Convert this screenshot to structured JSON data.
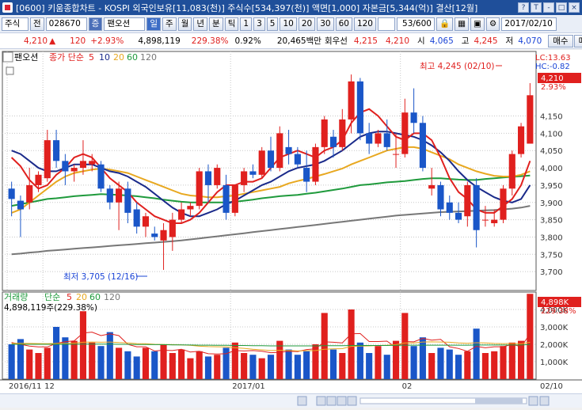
{
  "titlebar": {
    "title": "[0600] 키움종합차트 - KOSPI 외국인보유[11,083(천)] 주식수[534,397(천)] 액면[1,000] 자본금[5,344(억)] 결산[12월]",
    "buttons": [
      "?",
      "T",
      "-",
      "□",
      "×"
    ]
  },
  "toolbar": {
    "market": "주식",
    "all_label": "전",
    "code": "028670",
    "badge": "증",
    "stock_name": "팬오션",
    "periods": [
      "일",
      "주",
      "월",
      "년",
      "분",
      "틱"
    ],
    "active_period": "일",
    "minutes": [
      "1",
      "3",
      "5",
      "10",
      "20",
      "30",
      "60",
      "120"
    ],
    "count": "53/600",
    "date": "2017/02/10"
  },
  "pricebar": {
    "price": "4,210",
    "change_arrow": "▲",
    "change": "120",
    "change_pct": "+2.93%",
    "volume": "4,898,119",
    "volume_ratio": "229.38%",
    "turnover": "0.92%",
    "amount": "20,465백만",
    "reset_label": "회우선",
    "ask": "4,215",
    "bid": "4,210",
    "open_label": "시",
    "open": "4,065",
    "high_label": "고",
    "high": "4,245",
    "low_label": "저",
    "low": "4,070",
    "buy_label": "매수",
    "sell_label": "매도"
  },
  "price_panel": {
    "name": "팬오션",
    "legend_prefix": "종가 단순",
    "legend_periods": [
      "5",
      "10",
      "20",
      "60",
      "120"
    ],
    "lc": "LC:13.63",
    "hc": "HC:-0.82",
    "last_price": "4,210",
    "last_pct": "2.93%",
    "high_annotation": "최고 4,245 (02/10)",
    "low_annotation": "최저 3,705 (12/16)"
  },
  "volume_panel": {
    "name": "거래량",
    "legend_prefix": "단순",
    "legend_periods": [
      "5",
      "20",
      "60",
      "120"
    ],
    "info": "4,898,119주(229.38%)",
    "last_volume": "4,898K",
    "last_pct": "229.38%"
  },
  "xaxis": {
    "labels": [
      {
        "text": "2016/11",
        "idx": 0
      },
      {
        "text": "12",
        "idx": 4
      },
      {
        "text": "2017/01",
        "idx": 25
      },
      {
        "text": "02",
        "idx": 44
      }
    ],
    "right_label": "02/10"
  },
  "colors": {
    "up": "#e0201e",
    "down": "#1a56c8",
    "ma5": "#e0201e",
    "ma10": "#1a2a8a",
    "ma20": "#e8a820",
    "ma60": "#1f9a3c",
    "ma120": "#777777"
  },
  "chart_data": {
    "type": "candlestick",
    "ylim": [
      3650,
      4300
    ],
    "yticks": [
      3700,
      3750,
      3800,
      3850,
      3900,
      3950,
      4000,
      4050,
      4100,
      4150
    ],
    "vol_yticks": [
      1000000,
      2000000,
      3000000,
      4000000
    ],
    "vol_ylim": [
      0,
      5000000
    ],
    "candles": [
      [
        3940,
        3960,
        3860,
        3910
      ],
      [
        3905,
        3920,
        3800,
        3880
      ],
      [
        3900,
        4000,
        3880,
        3950
      ],
      [
        3950,
        3990,
        3930,
        3980
      ],
      [
        3970,
        4110,
        3960,
        4080
      ],
      [
        4080,
        4110,
        4000,
        4020
      ],
      [
        4020,
        4040,
        3950,
        3990
      ],
      [
        3990,
        4010,
        3960,
        4000
      ],
      [
        4000,
        4080,
        3980,
        4020
      ],
      [
        4010,
        4040,
        3990,
        4020
      ],
      [
        4010,
        4020,
        3930,
        3940
      ],
      [
        3940,
        3950,
        3880,
        3900
      ],
      [
        3900,
        3960,
        3820,
        3940
      ],
      [
        3940,
        3960,
        3840,
        3870
      ],
      [
        3880,
        3900,
        3810,
        3830
      ],
      [
        3830,
        3870,
        3800,
        3860
      ],
      [
        3810,
        3830,
        3790,
        3800
      ],
      [
        3790,
        3840,
        3705,
        3820
      ],
      [
        3800,
        3870,
        3760,
        3850
      ],
      [
        3850,
        3900,
        3840,
        3880
      ],
      [
        3880,
        3900,
        3860,
        3890
      ],
      [
        3890,
        4000,
        3880,
        3990
      ],
      [
        3990,
        4010,
        3900,
        3950
      ],
      [
        3950,
        4010,
        3940,
        4000
      ],
      [
        3950,
        3980,
        3850,
        3870
      ],
      [
        3870,
        3950,
        3860,
        3950
      ],
      [
        3950,
        4000,
        3930,
        3990
      ],
      [
        3990,
        4010,
        3970,
        3980
      ],
      [
        3980,
        4060,
        3970,
        4050
      ],
      [
        4050,
        4090,
        3990,
        4000
      ],
      [
        4000,
        4120,
        3990,
        4100
      ],
      [
        4060,
        4110,
        4010,
        4040
      ],
      [
        4040,
        4060,
        4000,
        4010
      ],
      [
        4000,
        4050,
        3930,
        3960
      ],
      [
        3960,
        4070,
        3950,
        4060
      ],
      [
        4060,
        4150,
        4040,
        4140
      ],
      [
        4090,
        4110,
        4030,
        4060
      ],
      [
        4060,
        4170,
        4050,
        4140
      ],
      [
        4140,
        4270,
        4100,
        4250
      ],
      [
        4250,
        4260,
        4080,
        4100
      ],
      [
        4100,
        4130,
        4040,
        4070
      ],
      [
        4070,
        4110,
        4060,
        4100
      ],
      [
        4100,
        4140,
        4050,
        4060
      ],
      [
        4040,
        4100,
        4000,
        4040
      ],
      [
        4040,
        4200,
        4030,
        4160
      ],
      [
        4160,
        4230,
        4100,
        4130
      ],
      [
        4130,
        4150,
        3990,
        4000
      ],
      [
        3940,
        4000,
        3920,
        3950
      ],
      [
        3950,
        3960,
        3860,
        3880
      ],
      [
        3900,
        3920,
        3850,
        3870
      ],
      [
        3870,
        3900,
        3840,
        3850
      ],
      [
        3860,
        3960,
        3830,
        3950
      ],
      [
        3950,
        3970,
        3770,
        3820
      ],
      [
        3850,
        3890,
        3830,
        3850
      ],
      [
        3840,
        3880,
        3830,
        3850
      ],
      [
        3850,
        3950,
        3840,
        3940
      ],
      [
        3940,
        4050,
        3920,
        4040
      ],
      [
        4040,
        4130,
        4030,
        4120
      ],
      [
        4070,
        4245,
        4070,
        4210
      ]
    ],
    "volumes": [
      2000000,
      2300000,
      1700000,
      1500000,
      1800000,
      3000000,
      2400000,
      2200000,
      3900000,
      2100000,
      1900000,
      2700000,
      1800000,
      1600000,
      1300000,
      1800000,
      1600000,
      2000000,
      1500000,
      1700000,
      1200000,
      1600000,
      1300000,
      1400000,
      1800000,
      2100000,
      1500000,
      1400000,
      1200000,
      1400000,
      2200000,
      1700000,
      1400000,
      1600000,
      2000000,
      3800000,
      1700000,
      1500000,
      4000000,
      2100000,
      1500000,
      1900000,
      1400000,
      2200000,
      3800000,
      1900000,
      2400000,
      1500000,
      1800000,
      1700000,
      1400000,
      1600000,
      2900000,
      1500000,
      1600000,
      1900000,
      2100000,
      2200000,
      4898000
    ],
    "ma": {
      "ma5": [
        4030,
        4005,
        3965,
        3940,
        3950,
        3980,
        4000,
        4030,
        4040,
        4030,
        4000,
        3970,
        3950,
        3930,
        3900,
        3880,
        3860,
        3850,
        3840,
        3840,
        3850,
        3870,
        3900,
        3930,
        3950,
        3950,
        3960,
        3960,
        3970,
        4000,
        4030,
        4040,
        4050,
        4040,
        4030,
        4050,
        4060,
        4080,
        4130,
        4160,
        4170,
        4150,
        4120,
        4090,
        4080,
        4100,
        4100,
        4080,
        4030,
        3970,
        3930,
        3910,
        3880,
        3870,
        3870,
        3890,
        3910,
        3950,
        4020
      ],
      "ma10": [
        4050,
        4040,
        4020,
        4000,
        3990,
        3990,
        4000,
        4010,
        4010,
        4010,
        4000,
        3990,
        3985,
        3975,
        3960,
        3945,
        3925,
        3905,
        3885,
        3870,
        3860,
        3860,
        3870,
        3880,
        3895,
        3905,
        3920,
        3935,
        3950,
        3960,
        3975,
        3990,
        4000,
        4005,
        4010,
        4020,
        4035,
        4050,
        4070,
        4090,
        4100,
        4105,
        4105,
        4100,
        4095,
        4090,
        4080,
        4065,
        4045,
        4020,
        3990,
        3965,
        3945,
        3930,
        3915,
        3905,
        3900,
        3910,
        3950
      ],
      "ma20": [
        3870,
        3880,
        3900,
        3920,
        3940,
        3960,
        3975,
        3985,
        3990,
        3995,
        3998,
        3995,
        3990,
        3985,
        3975,
        3965,
        3955,
        3945,
        3935,
        3925,
        3920,
        3918,
        3915,
        3915,
        3918,
        3920,
        3925,
        3930,
        3935,
        3940,
        3945,
        3955,
        3962,
        3968,
        3975,
        3982,
        3990,
        3998,
        4010,
        4020,
        4030,
        4040,
        4050,
        4055,
        4060,
        4060,
        4055,
        4045,
        4035,
        4025,
        4010,
        4000,
        3990,
        3983,
        3977,
        3975,
        3975,
        3980,
        3990
      ],
      "ma60": [
        3890,
        3895,
        3900,
        3905,
        3910,
        3912,
        3915,
        3918,
        3920,
        3922,
        3924,
        3923,
        3922,
        3920,
        3918,
        3915,
        3912,
        3908,
        3905,
        3902,
        3900,
        3900,
        3900,
        3900,
        3900,
        3902,
        3905,
        3908,
        3912,
        3915,
        3918,
        3920,
        3922,
        3925,
        3928,
        3932,
        3936,
        3940,
        3945,
        3950,
        3952,
        3955,
        3958,
        3960,
        3962,
        3965,
        3968,
        3970,
        3970,
        3968,
        3966,
        3965,
        3965,
        3968,
        3970,
        3972,
        3974,
        3976,
        3978
      ],
      "ma120": [
        3750,
        3752,
        3755,
        3757,
        3760,
        3762,
        3764,
        3766,
        3768,
        3770,
        3772,
        3774,
        3776,
        3778,
        3780,
        3782,
        3784,
        3786,
        3788,
        3790,
        3793,
        3796,
        3799,
        3802,
        3805,
        3808,
        3811,
        3814,
        3817,
        3820,
        3823,
        3826,
        3829,
        3832,
        3835,
        3838,
        3841,
        3844,
        3847,
        3850,
        3853,
        3856,
        3859,
        3862,
        3864,
        3866,
        3868,
        3870,
        3872,
        3873,
        3874,
        3875,
        3876,
        3877,
        3878,
        3880,
        3882,
        3885,
        3890
      ]
    },
    "vol_ma": {
      "ma5": [
        2100000,
        2000000,
        1900000,
        1850000,
        1850000,
        2050000,
        2150000,
        2200000,
        2650000,
        2700000,
        2500000,
        2600000,
        2500000,
        2000000,
        1860000,
        1860000,
        1620000,
        1660000,
        1640000,
        1720000,
        1560000,
        1600000,
        1460000,
        1440000,
        1460000,
        1640000,
        1620000,
        1640000,
        1600000,
        1520000,
        1540000,
        1600000,
        1580000,
        1700000,
        1740000,
        2140000,
        2120000,
        2080000,
        2600000,
        2620000,
        2160000,
        2160000,
        2180000,
        1820000,
        2160000,
        2140000,
        2340000,
        2240000,
        2280000,
        1860000,
        1760000,
        1600000,
        1880000,
        1800000,
        1860000,
        1860000,
        2000000,
        1860000,
        2600000
      ],
      "ma20": [
        2050000,
        2060000,
        2050000,
        2040000,
        2030000,
        2050000,
        2060000,
        2070000,
        2120000,
        2130000,
        2120000,
        2130000,
        2100000,
        2080000,
        2040000,
        2030000,
        2000000,
        1990000,
        1980000,
        1970000,
        1940000,
        1890000,
        1870000,
        1860000,
        1850000,
        1800000,
        1770000,
        1720000,
        1680000,
        1640000,
        1660000,
        1650000,
        1620000,
        1630000,
        1640000,
        1720000,
        1740000,
        1750000,
        1880000,
        1900000,
        1910000,
        1930000,
        1950000,
        1980000,
        2080000,
        2080000,
        2130000,
        2140000,
        2130000,
        2120000,
        2080000,
        2060000,
        2090000,
        2080000,
        2050000,
        2040000,
        2050000,
        2030000,
        2120000
      ],
      "ma60": [
        2000000,
        2000000,
        2000000,
        2000000,
        2000000,
        2000000,
        2000000,
        2000000,
        2010000,
        2010000,
        2010000,
        2010000,
        2000000,
        2000000,
        1990000,
        1990000,
        1980000,
        1980000,
        1970000,
        1970000,
        1960000,
        1950000,
        1950000,
        1940000,
        1940000,
        1930000,
        1930000,
        1920000,
        1920000,
        1910000,
        1910000,
        1910000,
        1910000,
        1910000,
        1910000,
        1920000,
        1920000,
        1920000,
        1930000,
        1930000,
        1930000,
        1930000,
        1930000,
        1940000,
        1950000,
        1950000,
        1950000,
        1950000,
        1950000,
        1950000,
        1950000,
        1950000,
        1960000,
        1960000,
        1960000,
        1960000,
        1960000,
        1960000,
        1990000
      ]
    }
  }
}
